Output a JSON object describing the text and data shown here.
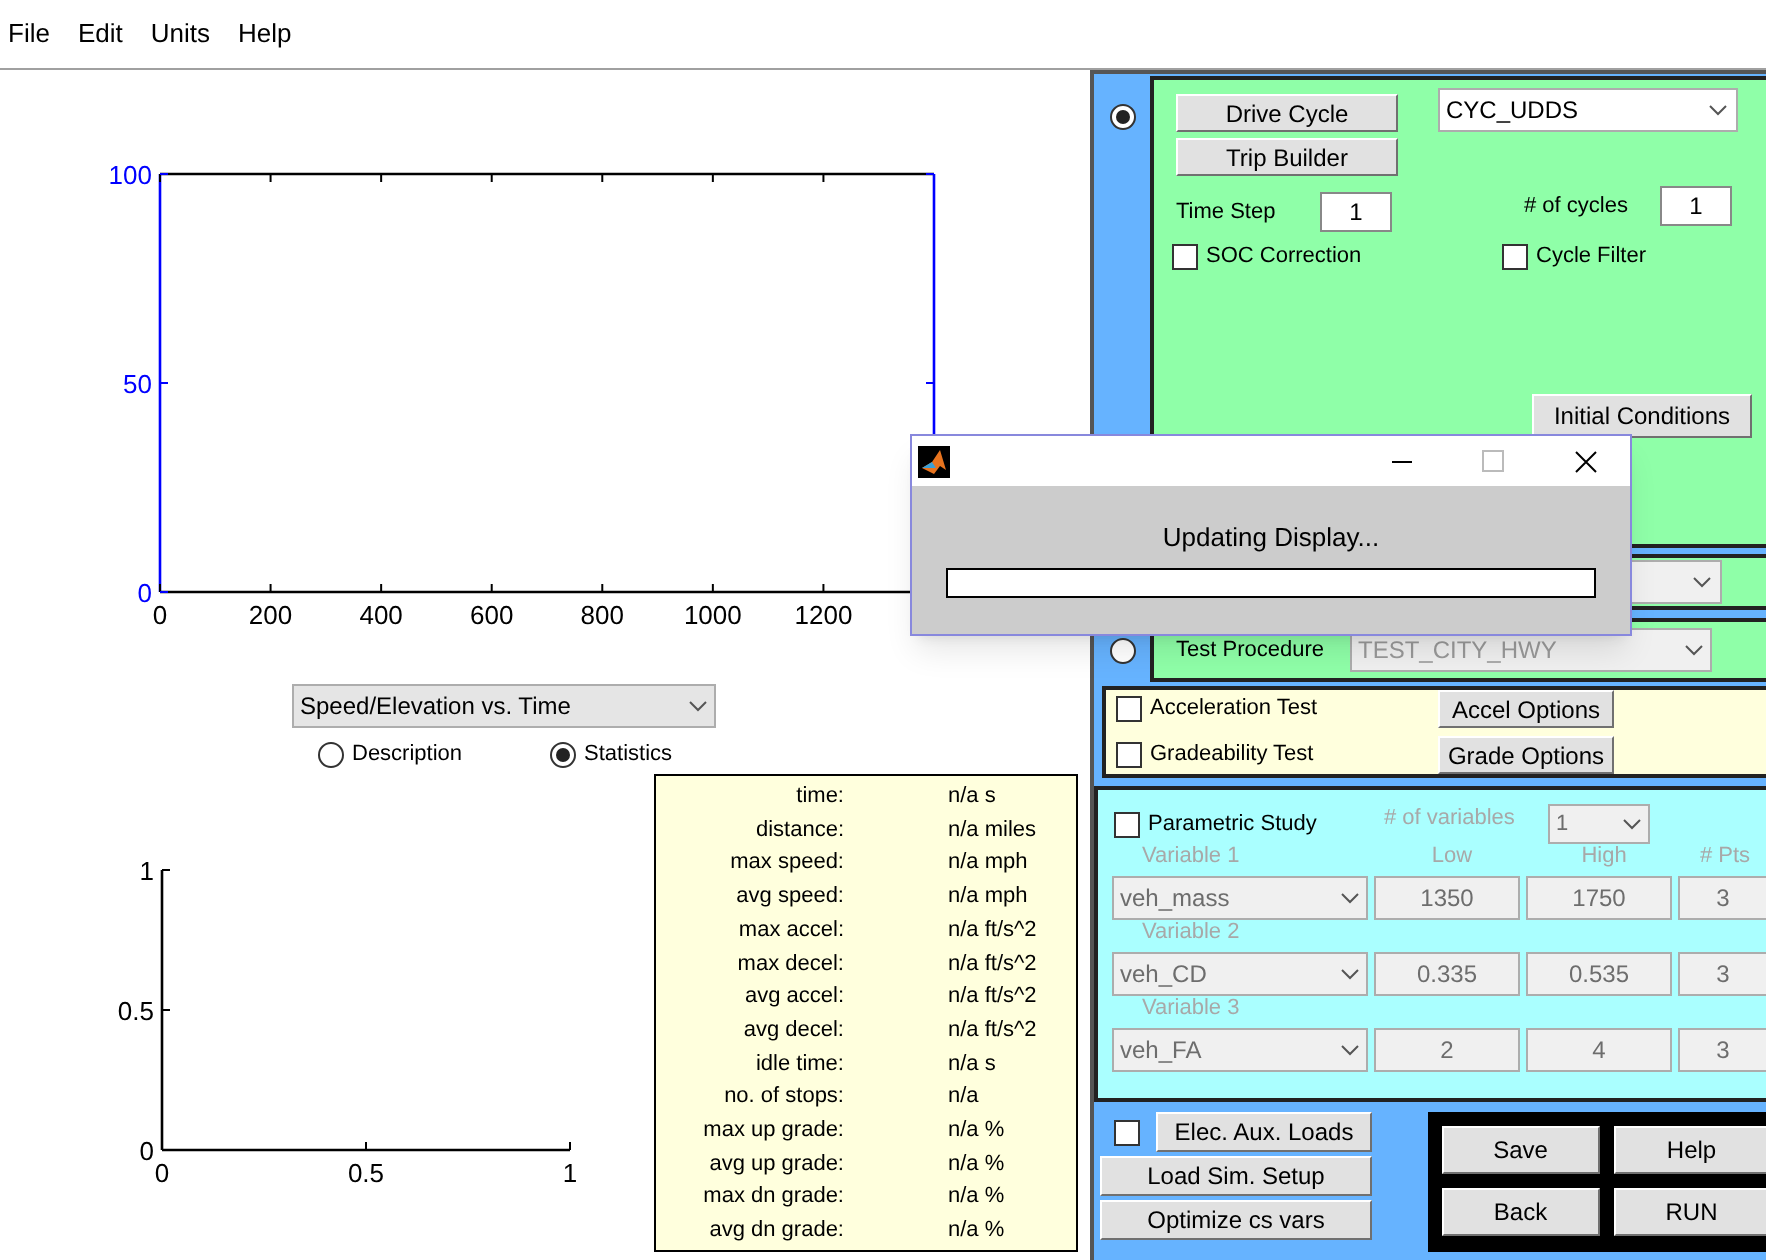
{
  "menu": [
    {
      "label": "File"
    },
    {
      "label": "Edit"
    },
    {
      "label": "Units"
    },
    {
      "label": "Help"
    }
  ],
  "top_chart": {
    "chart_data": {
      "type": "line",
      "xlim": [
        0,
        1400
      ],
      "ylim": [
        0,
        100
      ],
      "xticks": [
        0,
        200,
        400,
        600,
        800,
        1000,
        1200
      ],
      "yticks": [
        0,
        50,
        100
      ]
    }
  },
  "plot_selector": {
    "value": "Speed/Elevation vs. Time"
  },
  "view_options": [
    {
      "label": "Description",
      "selected": false
    },
    {
      "label": "Statistics",
      "selected": true
    }
  ],
  "statistics": [
    {
      "label": "time:",
      "value": "n/a s"
    },
    {
      "label": "distance:",
      "value": "n/a miles"
    },
    {
      "label": "max speed:",
      "value": "n/a mph"
    },
    {
      "label": "avg speed:",
      "value": "n/a mph"
    },
    {
      "label": "max accel:",
      "value": "n/a ft/s^2"
    },
    {
      "label": "max decel:",
      "value": "n/a ft/s^2"
    },
    {
      "label": "avg accel:",
      "value": "n/a ft/s^2"
    },
    {
      "label": "avg decel:",
      "value": "n/a ft/s^2"
    },
    {
      "label": "idle time:",
      "value": "n/a s"
    },
    {
      "label": "no. of stops:",
      "value": "n/a"
    },
    {
      "label": "max up grade:",
      "value": "n/a %"
    },
    {
      "label": "avg up grade:",
      "value": "n/a %"
    },
    {
      "label": "max dn grade:",
      "value": "n/a %"
    },
    {
      "label": "avg dn grade:",
      "value": "n/a %"
    }
  ],
  "bottom_chart": {
    "chart_data": {
      "type": "line",
      "xlim": [
        0,
        1
      ],
      "ylim": [
        0,
        1
      ],
      "xticks": [
        0,
        0.5,
        1
      ],
      "yticks": [
        0,
        0.5,
        1
      ]
    }
  },
  "drive_cycle": {
    "selected": true,
    "buttons": [
      "Drive Cycle",
      "Trip Builder"
    ],
    "cycle": "CYC_UDDS",
    "time_step_label": "Time Step",
    "time_step": "1",
    "cycles_label": "# of cycles",
    "cycles": "1",
    "options": [
      {
        "label": "SOC Correction",
        "checked": false
      },
      {
        "label": "Cycle Filter",
        "checked": false
      }
    ],
    "initial_conditions": "Initial Conditions"
  },
  "test_procedure": {
    "selected": false,
    "label": "Test Procedure",
    "value": "TEST_CITY_HWY",
    "disabled": true
  },
  "tests": [
    {
      "label": "Acceleration Test",
      "checked": false,
      "button": "Accel Options"
    },
    {
      "label": "Gradeability Test",
      "checked": false,
      "button": "Grade Options"
    }
  ],
  "parametric": {
    "label": "Parametric Study",
    "checked": false,
    "disabled": true,
    "count_label": "# of variables",
    "count": "1",
    "headers": [
      "Low",
      "High",
      "# Pts"
    ],
    "variables": [
      {
        "label": "Variable 1",
        "name": "veh_mass",
        "low": "1350",
        "high": "1750",
        "pts": "3"
      },
      {
        "label": "Variable 2",
        "name": "veh_CD",
        "low": "0.335",
        "high": "0.535",
        "pts": "3"
      },
      {
        "label": "Variable 3",
        "name": "veh_FA",
        "low": "2",
        "high": "4",
        "pts": "3"
      }
    ]
  },
  "elec_aux": {
    "label": "Elec. Aux. Loads",
    "checked": false
  },
  "setup_buttons": [
    "Load Sim. Setup",
    "Optimize cs vars"
  ],
  "actions": [
    "Save",
    "Help",
    "Back",
    "RUN"
  ],
  "dialog": {
    "message": "Updating Display...",
    "level": 0
  }
}
